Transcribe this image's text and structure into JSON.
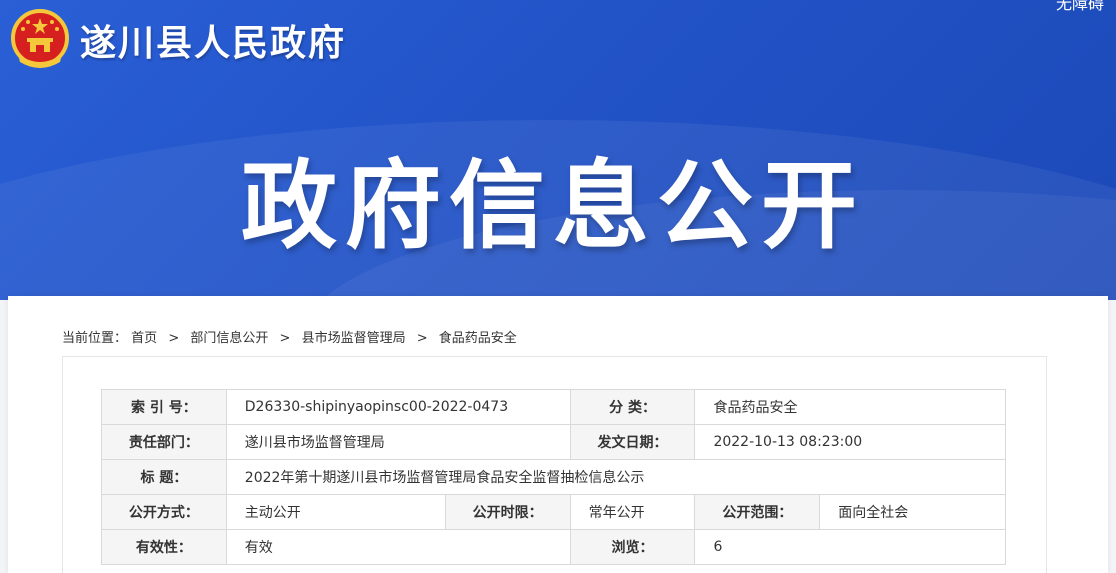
{
  "header": {
    "site_name": "遂川县人民政府",
    "accessibility_link": "无障碍",
    "banner_title": "政府信息公开"
  },
  "breadcrumb": {
    "label": "当前位置：",
    "items": [
      "首页",
      "部门信息公开",
      "县市场监督管理局",
      "食品药品安全"
    ],
    "separator": ">"
  },
  "meta": {
    "index_label": "索 引 号：",
    "index_value": "D26330-shipinyaopinsc00-2022-0473",
    "category_label": "分 类：",
    "category_value": "食品药品安全",
    "dept_label": "责任部门：",
    "dept_value": "遂川县市场监督管理局",
    "date_label": "发文日期：",
    "date_value": "2022-10-13 08:23:00",
    "title_label": "标 题：",
    "title_value": "2022年第十期遂川县市场监督管理局食品安全监督抽检信息公示",
    "method_label": "公开方式：",
    "method_value": "主动公开",
    "period_label": "公开时限：",
    "period_value": "常年公开",
    "scope_label": "公开范围：",
    "scope_value": "面向全社会",
    "validity_label": "有效性：",
    "validity_value": "有效",
    "views_label": "浏览：",
    "views_value": "6"
  },
  "colors": {
    "banner_blue": "#2253c7",
    "emblem_red": "#d6201f",
    "emblem_gold": "#f5c83b"
  }
}
